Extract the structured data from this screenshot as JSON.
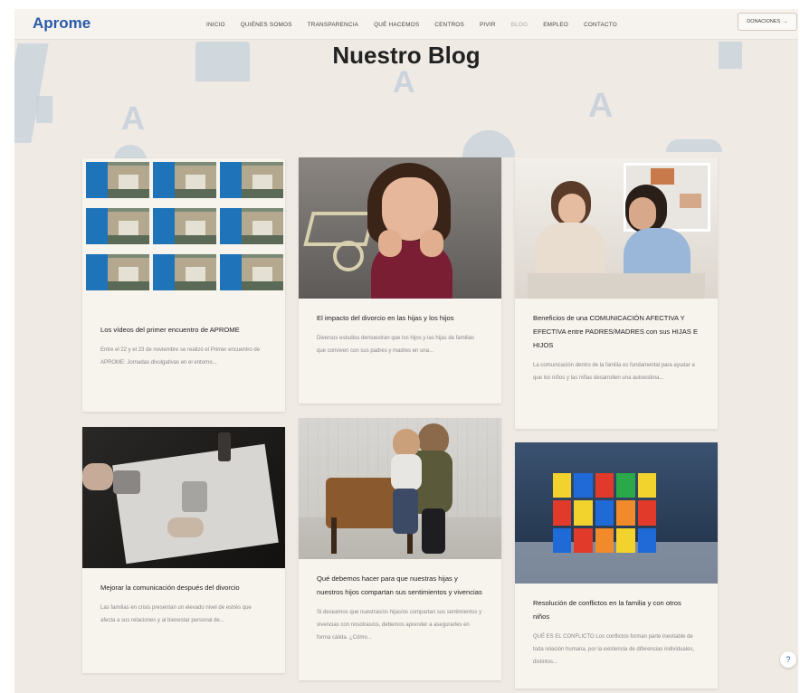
{
  "header": {
    "logo": "Aprome",
    "nav": [
      "INICIO",
      "QUIÉNES SOMOS",
      "TRANSPARENCIA",
      "QUÉ HACEMOS",
      "CENTROS",
      "PIVIR",
      "BLOG",
      "EMPLEO",
      "CONTACTO"
    ],
    "active_nav": "BLOG",
    "donate_label": "DONACIONES",
    "donate_arrow": "→"
  },
  "page_title": "Nuestro Blog",
  "videos_grid": {
    "captions": [
      "",
      "",
      "",
      "",
      "",
      "",
      "",
      "",
      ""
    ]
  },
  "posts": [
    {
      "title": "Los vídeos del primer encuentro de APROME",
      "excerpt": "Entre el 22 y el 23 de noviembre se realizó el Primer encuentro de APROME: Jornadas divulgativas en el entorno..."
    },
    {
      "title": "El impacto del divorcio en las hijas y los hijos",
      "excerpt": "Diversos estudios demuestran que los hijos y las hijas de familias que conviven con sus padres y madres en una..."
    },
    {
      "title": "Beneficios de una COMUNICACIÓN AFECTIVA Y EFECTIVA entre PADRES/MADRES con sus HIJAS E HIJOS",
      "excerpt": "La comunicación dentro de la familia es fundamental para ayudar a que los niños y las niñas desarrollen una autoestima..."
    },
    {
      "title": "Mejorar la comunicación después del divorcio",
      "excerpt": "Las familias en crisis presentan un elevado nivel de estrés que afecta a sus relaciones y al bienestar personal de..."
    },
    {
      "title": "Qué debemos hacer para que nuestras hijas y nuestros hijos compartan sus sentimientos y vivencias",
      "excerpt": "Si deseamos que nuestras/os hijas/os compartan sus sentimientos y vivencias con nosotras/os, debemos aprender a asegurarles en forma cálida. ¿Cómo..."
    },
    {
      "title": "Resolución de conflictos en la familia y con otros niños",
      "excerpt": "QUÉ ES EL CONFLICTO Los conflictos forman parte inevitable de toda relación humana, por la existencia de diferencias individuales, distintos..."
    }
  ],
  "help_icon_glyph": "?",
  "colors": {
    "brand_blue": "#2a5aa8",
    "page_bg": "#efeae4",
    "card_bg": "#f7f3ed",
    "decor": "#c6d0db"
  }
}
